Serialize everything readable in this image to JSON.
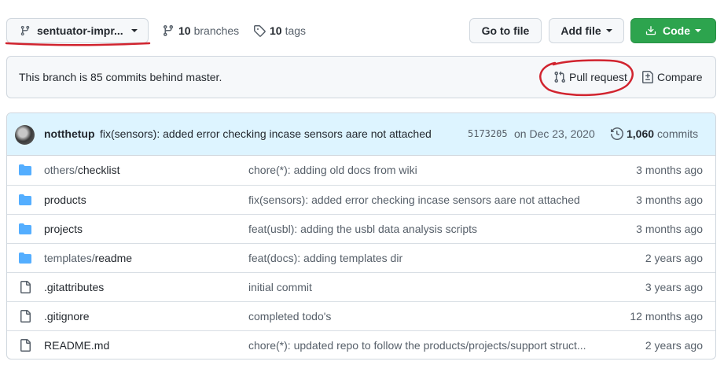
{
  "topbar": {
    "branch_name": "sentuator-impr...",
    "branches_count": "10",
    "branches_label": "branches",
    "tags_count": "10",
    "tags_label": "tags",
    "go_to_file": "Go to file",
    "add_file": "Add file",
    "code": "Code"
  },
  "notice": {
    "text": "This branch is 85 commits behind master.",
    "pull_request": "Pull request",
    "compare": "Compare"
  },
  "latest_commit": {
    "author": "notthetup",
    "message": "fix(sensors): added error checking incase sensors aare not attached",
    "sha": "5173205",
    "date": "on Dec 23, 2020",
    "count": "1,060",
    "count_label": "commits"
  },
  "files": [
    {
      "type": "folder",
      "dir": "others/",
      "name": "checklist",
      "message": "chore(*): adding old docs from wiki",
      "age": "3 months ago"
    },
    {
      "type": "folder",
      "dir": "",
      "name": "products",
      "message": "fix(sensors): added error checking incase sensors aare not attached",
      "age": "3 months ago"
    },
    {
      "type": "folder",
      "dir": "",
      "name": "projects",
      "message": "feat(usbl): adding the usbl data analysis scripts",
      "age": "3 months ago"
    },
    {
      "type": "folder",
      "dir": "templates/",
      "name": "readme",
      "message": "feat(docs): adding templates dir",
      "age": "2 years ago"
    },
    {
      "type": "file",
      "dir": "",
      "name": ".gitattributes",
      "message": "initial commit",
      "age": "3 years ago"
    },
    {
      "type": "file",
      "dir": "",
      "name": ".gitignore",
      "message": "completed todo's",
      "age": "12 months ago"
    },
    {
      "type": "file",
      "dir": "",
      "name": "README.md",
      "message": "chore(*): updated repo to follow the products/projects/support struct...",
      "age": "2 years ago"
    }
  ],
  "colors": {
    "accent_green": "#2da44e",
    "annotation_red": "#d1242f",
    "folder_blue": "#54aeff"
  }
}
